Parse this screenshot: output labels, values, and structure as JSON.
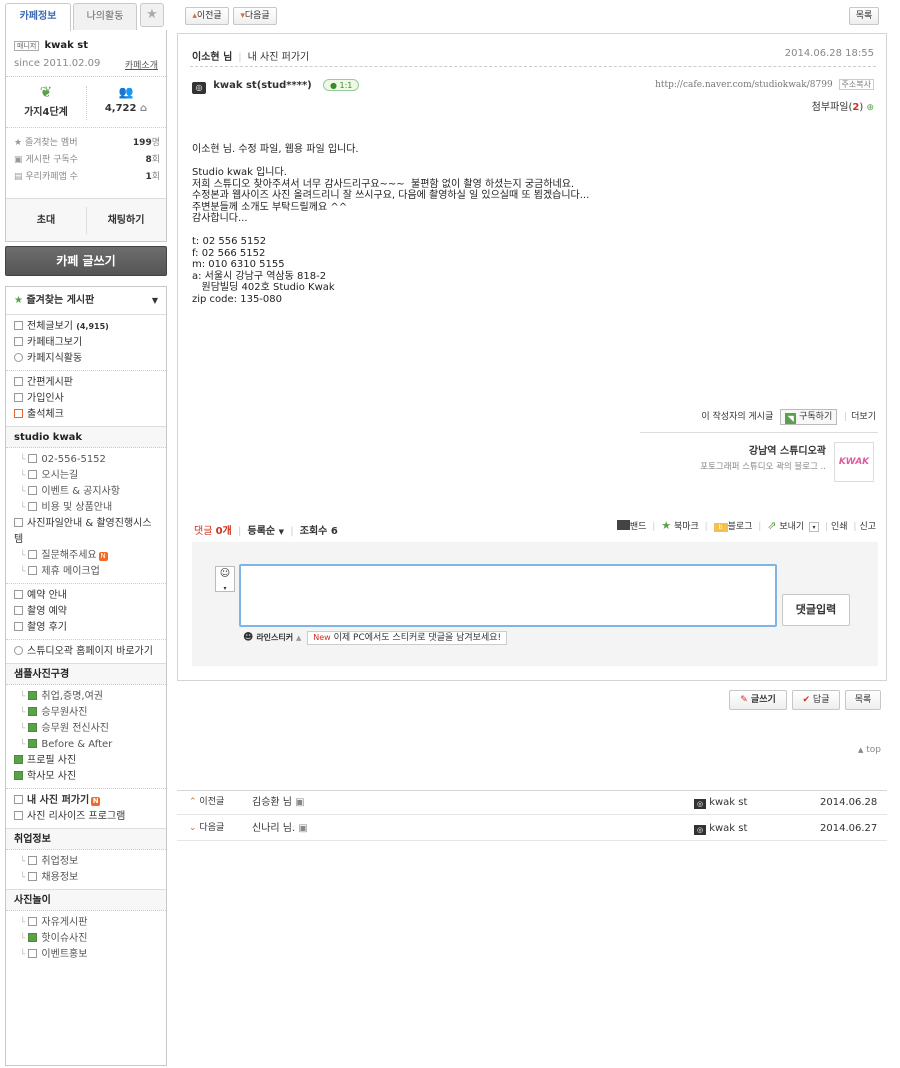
{
  "sidebar": {
    "tabs": [
      "카페정보",
      "나의활동"
    ],
    "profile": {
      "badge": "매니저",
      "name": "kwak st",
      "since": "since 2011.02.09",
      "intro_link": "카페소개"
    },
    "stats_top": [
      {
        "label": "가지4단계",
        "icon": "tree-icon"
      },
      {
        "label": "4,722",
        "icon": "members-icon"
      }
    ],
    "stats_list": [
      {
        "label": "즐겨찾는 멤버",
        "value": "199",
        "unit": "명"
      },
      {
        "label": "게시판 구독수",
        "value": "8",
        "unit": "회"
      },
      {
        "label": "우리카페앱 수",
        "value": "1",
        "unit": "회"
      }
    ],
    "invite_button": "초대",
    "chat_button": "채팅하기",
    "write_button": "카페 글쓰기",
    "favorites_title": "즐겨찾는 게시판",
    "group1": [
      {
        "label": "전체글보기",
        "count": "(4,915)"
      },
      {
        "label": "카페태그보기"
      },
      {
        "label": "카페지식활동"
      }
    ],
    "group2": [
      "간편게시판",
      "가입인사",
      "출석체크"
    ],
    "sec_studio": "studio kwak",
    "studio_items": [
      "02-556-5152",
      "오시는길",
      "이벤트 & 공지사항",
      "비용 및 상품안내"
    ],
    "studio_long": "사진파일안내 & 촬영진행시스템",
    "studio_sub": [
      "질문해주세요",
      "제휴 메이크업"
    ],
    "group3": [
      "예약 안내",
      "촬영 예약",
      "촬영 후기"
    ],
    "homepage_link": "스튜디오곽 홈페이지 바로가기",
    "sec_sample": "샘플사진구경",
    "sample_items": [
      "취업,증명,여권",
      "승무원사진",
      "승무원 전신사진",
      "Before & After"
    ],
    "sample_plain": [
      "프로필 사진",
      "학사모 사진"
    ],
    "group4": [
      "내 사진 퍼가기",
      "사진 리사이즈 프로그램"
    ],
    "sec_job": "취업정보",
    "job_items": [
      "취업정보",
      "채용정보"
    ],
    "sec_play": "사진놀이",
    "play_items": [
      "자유게시판",
      "핫이슈사진",
      "이벤트홍보"
    ]
  },
  "topnav": {
    "prev": "이전글",
    "next": "다음글",
    "list": "목록"
  },
  "post": {
    "author_to": "이소현 님",
    "board": "내 사진 퍼가기",
    "date": "2014.06.28 18:55",
    "writer": "kwak st(stud****)",
    "chat_badge": "1:1",
    "url": "http://cafe.naver.com/studiokwak/8799",
    "copy_addr": "주소복사",
    "attach_label": "첨부파일",
    "attach_count": "2",
    "body_lines": [
      "이소현 님. 수정 파일, 웹용 파일 입니다.",
      "",
      "Studio kwak 입니다.",
      "저희 스튜디오 찾아주셔서 너무 감사드리구요~~~  불편함 없이 촬영 하셨는지 궁금하네요.",
      "수정본과 웹사이즈 사진 올려드리니 잘 쓰시구요, 다음에 촬영하실 일 있으실때 또 뵙겠습니다...",
      "주변분들께 소개도 부탁드릴께요 ^^",
      "감사합니다...",
      "",
      "t: 02 556 5152",
      "f: 02 566 5152",
      "m: 010 6310 5155",
      "a: 서울시 강남구 역삼동 818-2",
      "   원담빌딩 402호 Studio Kwak",
      "zip code: 135-080"
    ],
    "author_posts": "이 작성자의 게시글",
    "subscribe": "구독하기",
    "more": "더보기",
    "blog_name": "강남역 스튜디오곽",
    "blog_desc": "포토그래퍼 스튜디오 곽의 블로그 ..",
    "blog_logo": "KWAK",
    "comment_label": "댓글",
    "comment_count": "0개",
    "sort_label": "등록순",
    "views_label": "조회수",
    "views": "6",
    "share": [
      "밴드",
      "북마크",
      "블로그",
      "보내기"
    ],
    "print": "인쇄",
    "report": "신고",
    "comment_submit": "댓글입력",
    "sticker_label": "라인스티커",
    "new_tag": "New",
    "sticker_notice": "이제 PC에서도 스티커로 댓글을 남겨보세요!"
  },
  "bottom": {
    "write": "글쓰기",
    "reply": "답글",
    "list": "목록",
    "top": "top",
    "prev_label": "이전글",
    "next_label": "다음글",
    "prev_title": "김승환 님",
    "next_title": "신나리 님.",
    "prev_author": "kwak st",
    "next_author": "kwak st",
    "prev_date": "2014.06.28",
    "next_date": "2014.06.27"
  },
  "colors": {
    "accent_green": "#5aa14a",
    "link_blue": "#3b6bb5",
    "red": "#d0301e",
    "focus_blue": "#7fb5e6"
  }
}
